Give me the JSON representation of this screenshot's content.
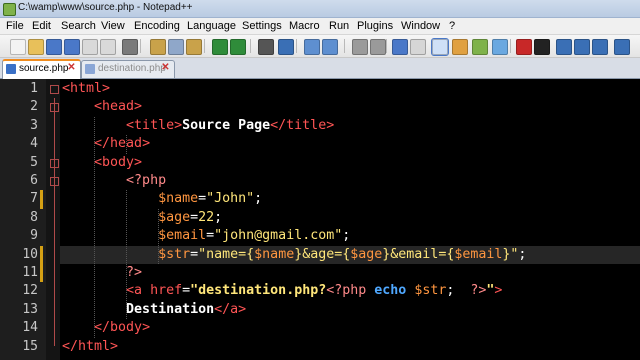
{
  "window": {
    "title": "C:\\wamp\\www\\source.php - Notepad++"
  },
  "menu": [
    "File",
    "Edit",
    "Search",
    "View",
    "Encoding",
    "Language",
    "Settings",
    "Macro",
    "Run",
    "Plugins",
    "Window",
    "?"
  ],
  "tabs": [
    {
      "label": "source.php",
      "active": true
    },
    {
      "label": "destination.php",
      "active": false
    }
  ],
  "editor": {
    "current_line": 10,
    "lines": [
      {
        "num": "1",
        "segs": [
          [
            "c-tag",
            "<html>"
          ]
        ]
      },
      {
        "num": "2",
        "segs": [
          [
            "c-op",
            "    "
          ],
          [
            "c-tag",
            "<head>"
          ]
        ]
      },
      {
        "num": "3",
        "segs": [
          [
            "c-op",
            "        "
          ],
          [
            "c-tag",
            "<title>"
          ],
          [
            "c-text",
            "Source Page"
          ],
          [
            "c-tag",
            "</title>"
          ]
        ]
      },
      {
        "num": "4",
        "segs": [
          [
            "c-op",
            "    "
          ],
          [
            "c-tag",
            "</head>"
          ]
        ]
      },
      {
        "num": "5",
        "segs": [
          [
            "c-op",
            "    "
          ],
          [
            "c-tag",
            "<body>"
          ]
        ]
      },
      {
        "num": "6",
        "segs": [
          [
            "c-op",
            "        "
          ],
          [
            "c-php",
            "<?php"
          ]
        ]
      },
      {
        "num": "7",
        "segs": [
          [
            "c-op",
            "            "
          ],
          [
            "c-var",
            "$name"
          ],
          [
            "c-op",
            "="
          ],
          [
            "c-str",
            "\"John\""
          ],
          [
            "c-op",
            ";"
          ]
        ]
      },
      {
        "num": "8",
        "segs": [
          [
            "c-op",
            "            "
          ],
          [
            "c-var",
            "$age"
          ],
          [
            "c-op",
            "="
          ],
          [
            "c-num",
            "22"
          ],
          [
            "c-op",
            ";"
          ]
        ]
      },
      {
        "num": "9",
        "segs": [
          [
            "c-op",
            "            "
          ],
          [
            "c-var",
            "$email"
          ],
          [
            "c-op",
            "="
          ],
          [
            "c-str",
            "\"john@gmail.com\""
          ],
          [
            "c-op",
            ";"
          ]
        ]
      },
      {
        "num": "10",
        "segs": [
          [
            "c-op",
            "            "
          ],
          [
            "c-var",
            "$str"
          ],
          [
            "c-op",
            "="
          ],
          [
            "c-str",
            "\"name={"
          ],
          [
            "c-var",
            "$name"
          ],
          [
            "c-str",
            "}&age={"
          ],
          [
            "c-var",
            "$age"
          ],
          [
            "c-str",
            "}&email={"
          ],
          [
            "c-var",
            "$email"
          ],
          [
            "c-str",
            "}\""
          ],
          [
            "c-op",
            ";"
          ]
        ]
      },
      {
        "num": "11",
        "segs": [
          [
            "c-op",
            "        "
          ],
          [
            "c-php",
            "?>"
          ]
        ]
      },
      {
        "num": "12",
        "segs": [
          [
            "c-op",
            "        "
          ],
          [
            "c-tag",
            "<a "
          ],
          [
            "c-attr",
            "href"
          ],
          [
            "c-op",
            "="
          ],
          [
            "c-yb",
            "\"destination.php?"
          ],
          [
            "c-php",
            "<?php "
          ],
          [
            "c-kw",
            "echo"
          ],
          [
            "c-op",
            " "
          ],
          [
            "c-var",
            "$str"
          ],
          [
            "c-op",
            ";  "
          ],
          [
            "c-php",
            "?>"
          ],
          [
            "c-yb",
            "\""
          ],
          [
            "c-tag",
            ">"
          ]
        ]
      },
      {
        "num": "13",
        "segs": [
          [
            "c-op",
            "        "
          ],
          [
            "c-bold",
            "Destination"
          ],
          [
            "c-tag",
            "</a>"
          ]
        ]
      },
      {
        "num": "14",
        "segs": [
          [
            "c-op",
            "    "
          ],
          [
            "c-tag",
            "</body>"
          ]
        ]
      },
      {
        "num": "15",
        "segs": [
          [
            "c-tag",
            "</html>"
          ]
        ]
      }
    ]
  },
  "toolbar_icons": [
    "new-file-icon",
    "open-file-icon",
    "save-icon",
    "save-all-icon",
    "close-icon",
    "close-all-icon",
    "print-icon",
    "cut-icon",
    "copy-icon",
    "paste-icon",
    "undo-icon",
    "redo-icon",
    "find-icon",
    "replace-icon",
    "zoom-in-icon",
    "zoom-out-icon",
    "sync-vertical-icon",
    "sync-horizontal-icon",
    "word-wrap-icon",
    "show-all-chars-icon",
    "indent-guide-icon",
    "user-lang-icon",
    "doc-map-icon",
    "function-list-icon",
    "record-macro-icon",
    "stop-record-icon",
    "play-macro-icon",
    "run-macro-multiple-icon",
    "save-macro-icon",
    "extra-icon"
  ]
}
